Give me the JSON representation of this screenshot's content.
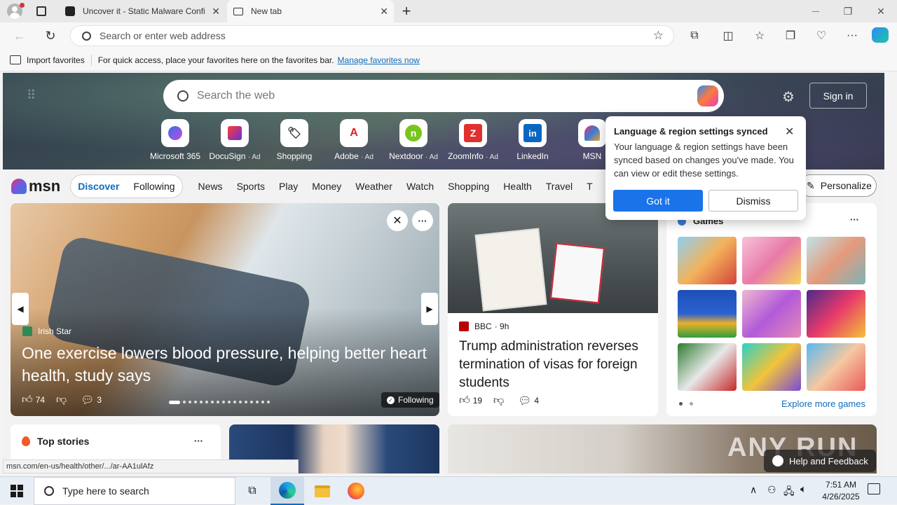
{
  "tabs": [
    {
      "title": "Uncover it - Static Malware Confi",
      "close": "✕"
    },
    {
      "title": "New tab",
      "close": "✕"
    }
  ],
  "new_tab_symbol": "+",
  "window_controls": {
    "minimize": "—",
    "restore": "❐",
    "close": "✕"
  },
  "address_bar": {
    "placeholder": "Search or enter web address"
  },
  "favorites_bar": {
    "import_label": "Import favorites",
    "hint_text": "For quick access, place your favorites here on the favorites bar.",
    "manage_link": "Manage favorites now"
  },
  "hero": {
    "search_placeholder": "Search the web",
    "sign_in": "Sign in",
    "quick_links": [
      {
        "label": "Microsoft 365",
        "ad": "",
        "color": "#6b5ce7"
      },
      {
        "label": "DocuSign",
        "ad": "· Ad",
        "color": "#d4145a"
      },
      {
        "label": "Shopping",
        "ad": "",
        "color": "#333333"
      },
      {
        "label": "Adobe",
        "ad": "· Ad",
        "color": "#e01f26"
      },
      {
        "label": "Nextdoor",
        "ad": "· Ad",
        "color": "#78c51b"
      },
      {
        "label": "ZoomInfo",
        "ad": "· Ad",
        "color": "#e03030"
      },
      {
        "label": "LinkedIn",
        "ad": "",
        "color": "#0a66c2"
      },
      {
        "label": "MSN",
        "ad": "",
        "color": "#3a7bd5"
      }
    ]
  },
  "msn_nav": {
    "logo": "msn",
    "discover": "Discover",
    "following": "Following",
    "items": [
      "News",
      "Sports",
      "Play",
      "Money",
      "Weather",
      "Watch",
      "Shopping",
      "Health",
      "Travel",
      "T"
    ],
    "personalize": "Personalize"
  },
  "lead_story": {
    "source": "Irish Star",
    "headline": "One exercise lowers blood pressure, helping better heart health, study says",
    "likes": "74",
    "comments": "3",
    "following": "Following"
  },
  "side_story": {
    "source": "BBC",
    "age": "· 9h",
    "headline": "Trump administration reverses termination of visas for foreign students",
    "likes": "19",
    "comments": "4"
  },
  "games": {
    "title": "Games",
    "more": "···",
    "explore": "Explore more games"
  },
  "top_stories": {
    "title": "Top stories",
    "more": "···"
  },
  "popup": {
    "title": "Language & region settings synced",
    "body": "Your language & region settings have been synced based on changes you've made. You can view or edit these settings.",
    "got_it": "Got it",
    "dismiss": "Dismiss"
  },
  "help_feedback": "Help and Feedback",
  "watermark": "ANY RUN",
  "status_url": "msn.com/en-us/health/other/.../ar-AA1ulAfz",
  "taskbar": {
    "search_placeholder": "Type here to search",
    "time": "7:51 AM",
    "date": "4/26/2025"
  },
  "colors": {
    "accent": "#0f6cbd",
    "popup_button": "#1a73e8"
  }
}
